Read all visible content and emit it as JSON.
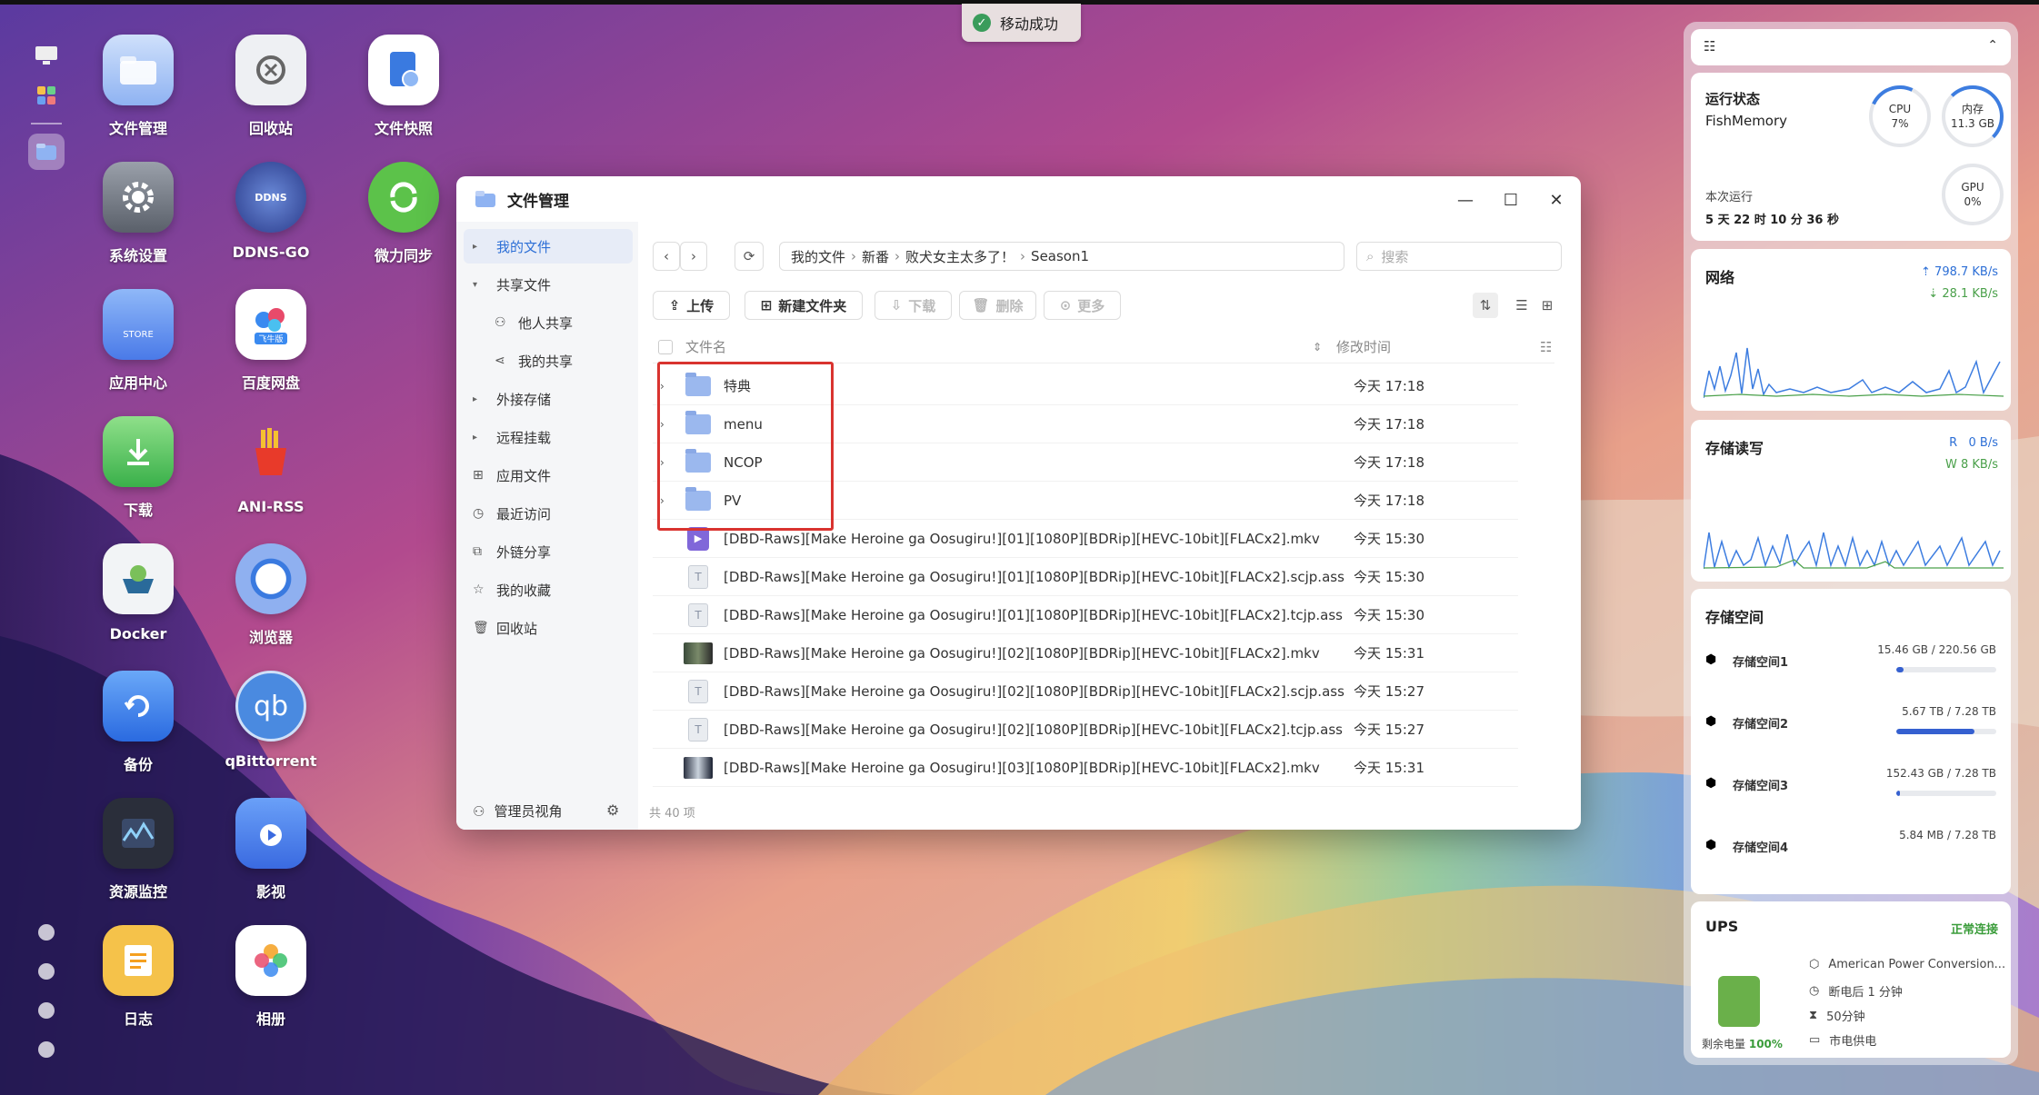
{
  "toast": {
    "text": "移动成功"
  },
  "desktop": {
    "icons": [
      {
        "label": "文件管理",
        "icon": "folder-icon"
      },
      {
        "label": "回收站",
        "icon": "recycle-icon"
      },
      {
        "label": "文件快照",
        "icon": "snapshot-icon"
      },
      {
        "label": "系统设置",
        "icon": "gear-icon"
      },
      {
        "label": "DDNS-GO",
        "icon": "globe-icon",
        "badge": "DDNS"
      },
      {
        "label": "微力同步",
        "icon": "sync-icon"
      },
      {
        "label": "应用中心",
        "icon": "store-icon",
        "badge": "STORE"
      },
      {
        "label": "百度网盘",
        "icon": "cloud-icon",
        "badge": "飞牛版"
      },
      {
        "label": "下载",
        "icon": "download-icon"
      },
      {
        "label": "ANI-RSS",
        "icon": "fries-icon"
      },
      {
        "label": "Docker",
        "icon": "docker-icon"
      },
      {
        "label": "浏览器",
        "icon": "chrome-icon"
      },
      {
        "label": "备份",
        "icon": "backup-icon"
      },
      {
        "label": "qBittorrent",
        "icon": "qbittorrent-icon",
        "badge": "qb"
      },
      {
        "label": "资源监控",
        "icon": "monitor-icon"
      },
      {
        "label": "影视",
        "icon": "video-icon"
      },
      {
        "label": "日志",
        "icon": "log-icon"
      },
      {
        "label": "相册",
        "icon": "photos-icon"
      }
    ]
  },
  "window": {
    "title": "文件管理",
    "sidebar": [
      {
        "label": "我的文件",
        "type": "expand",
        "active": true
      },
      {
        "label": "共享文件",
        "type": "expanded"
      },
      {
        "label": "他人共享",
        "type": "sub",
        "icon": "person-icon"
      },
      {
        "label": "我的共享",
        "type": "sub",
        "icon": "share-icon"
      },
      {
        "label": "外接存储",
        "type": "expand"
      },
      {
        "label": "远程挂载",
        "type": "expand"
      },
      {
        "label": "应用文件",
        "type": "icon",
        "icon": "apps-icon"
      },
      {
        "label": "最近访问",
        "type": "icon",
        "icon": "clock-icon"
      },
      {
        "label": "外链分享",
        "type": "icon",
        "icon": "link-icon"
      },
      {
        "label": "我的收藏",
        "type": "icon",
        "icon": "star-icon"
      },
      {
        "label": "回收站",
        "type": "icon",
        "icon": "trash-icon"
      }
    ],
    "footer": {
      "label": "管理员视角"
    },
    "path": [
      "我的文件",
      "新番",
      "败犬女主太多了！",
      "Season1"
    ],
    "search_placeholder": "搜索",
    "toolbar": {
      "upload": "上传",
      "new_folder": "新建文件夹",
      "download": "下载",
      "delete": "删除",
      "more": "更多"
    },
    "columns": {
      "name": "文件名",
      "modified": "修改时间"
    },
    "files": [
      {
        "name": "特典",
        "type": "folder",
        "time": "今天 17:18"
      },
      {
        "name": "menu",
        "type": "folder",
        "time": "今天 17:18"
      },
      {
        "name": "NCOP",
        "type": "folder",
        "time": "今天 17:18"
      },
      {
        "name": "PV",
        "type": "folder",
        "time": "今天 17:18"
      },
      {
        "name": "[DBD-Raws][Make Heroine ga Oosugiru!][01][1080P][BDRip][HEVC-10bit][FLACx2].mkv",
        "type": "video",
        "time": "今天 15:30"
      },
      {
        "name": "[DBD-Raws][Make Heroine ga Oosugiru!][01][1080P][BDRip][HEVC-10bit][FLACx2].scjp.ass",
        "type": "text",
        "time": "今天 15:30"
      },
      {
        "name": "[DBD-Raws][Make Heroine ga Oosugiru!][01][1080P][BDRip][HEVC-10bit][FLACx2].tcjp.ass",
        "type": "text",
        "time": "今天 15:30"
      },
      {
        "name": "[DBD-Raws][Make Heroine ga Oosugiru!][02][1080P][BDRip][HEVC-10bit][FLACx2].mkv",
        "type": "thumb",
        "time": "今天 15:31"
      },
      {
        "name": "[DBD-Raws][Make Heroine ga Oosugiru!][02][1080P][BDRip][HEVC-10bit][FLACx2].scjp.ass",
        "type": "text",
        "time": "今天 15:27"
      },
      {
        "name": "[DBD-Raws][Make Heroine ga Oosugiru!][02][1080P][BDRip][HEVC-10bit][FLACx2].tcjp.ass",
        "type": "text",
        "time": "今天 15:27"
      },
      {
        "name": "[DBD-Raws][Make Heroine ga Oosugiru!][03][1080P][BDRip][HEVC-10bit][FLACx2].mkv",
        "type": "thumb2",
        "time": "今天 15:31"
      }
    ],
    "status": "共 40 项"
  },
  "widgets": {
    "status": {
      "title": "运行状态",
      "host": "FishMemory",
      "cpu_label": "CPU",
      "cpu_value": "7%",
      "mem_label": "内存",
      "mem_value": "11.3 GB",
      "gpu_label": "GPU",
      "gpu_value": "0%",
      "uptime_label": "本次运行",
      "uptime": "5 天 22 时 10 分 36 秒"
    },
    "network": {
      "title": "网络",
      "up": "798.7 KB/s",
      "down": "28.1 KB/s"
    },
    "disk_io": {
      "title": "存储读写",
      "read_label": "R",
      "read": "0 B/s",
      "write_label": "W",
      "write": "8 KB/s"
    },
    "storage": {
      "title": "存储空间",
      "items": [
        {
          "name": "存储空间1",
          "used": "15.46 GB",
          "total": "220.56 GB",
          "fraction": 0.07
        },
        {
          "name": "存储空间2",
          "used": "5.67 TB",
          "total": "7.28 TB",
          "fraction": 0.78
        },
        {
          "name": "存储空间3",
          "used": "152.43 GB",
          "total": "7.28 TB",
          "fraction": 0.02
        },
        {
          "name": "存储空间4",
          "used": "5.84 MB",
          "total": "7.28 TB",
          "fraction": 0.0
        }
      ]
    },
    "ups": {
      "title": "UPS",
      "status": "正常连接",
      "battery_label": "剩余电量",
      "battery": "100%",
      "model": "American Power Conversion...",
      "shutdown": "断电后 1 分钟",
      "runtime": "50分钟",
      "power": "市电供电"
    }
  }
}
